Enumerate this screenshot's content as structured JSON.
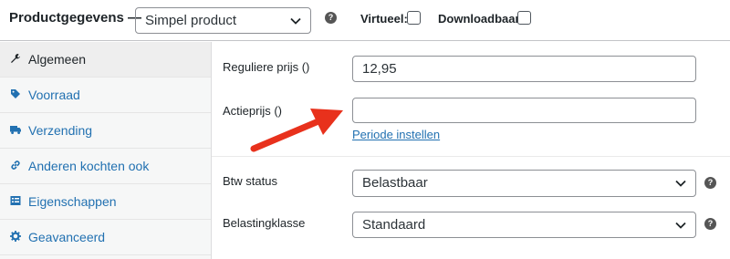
{
  "header": {
    "title": "Productgegevens —",
    "product_type": "Simpel product",
    "help_glyph": "?",
    "virtual_label": "Virtueel:",
    "downloadable_label": "Downloadbaar:"
  },
  "sidebar": {
    "items": [
      {
        "label": "Algemeen",
        "icon": "wrench-icon",
        "active": true
      },
      {
        "label": "Voorraad",
        "icon": "tag-icon",
        "active": false
      },
      {
        "label": "Verzending",
        "icon": "truck-icon",
        "active": false
      },
      {
        "label": "Anderen kochten ook",
        "icon": "link-icon",
        "active": false
      },
      {
        "label": "Eigenschappen",
        "icon": "list-icon",
        "active": false
      },
      {
        "label": "Geavanceerd",
        "icon": "gear-icon",
        "active": false
      }
    ]
  },
  "general": {
    "regular_price_label": "Reguliere prijs ()",
    "regular_price_value": "12,95",
    "sale_price_label": "Actieprijs ()",
    "sale_price_value": "",
    "schedule_link": "Periode instellen",
    "tax_status_label": "Btw status",
    "tax_status_value": "Belastbaar",
    "tax_class_label": "Belastingklasse",
    "tax_class_value": "Standaard"
  },
  "colors": {
    "accent": "#2271b1",
    "annotation_arrow": "#e8311c"
  }
}
